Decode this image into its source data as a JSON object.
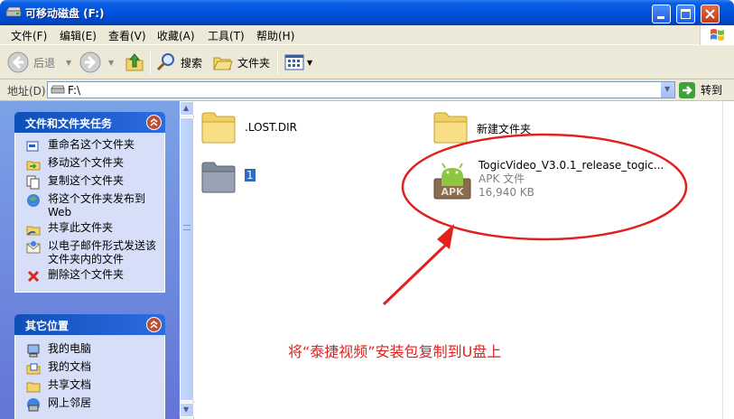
{
  "window": {
    "title": "可移动磁盘  (F:)"
  },
  "menu": [
    "文件(F)",
    "编辑(E)",
    "查看(V)",
    "收藏(A)",
    "工具(T)",
    "帮助(H)"
  ],
  "toolbar": {
    "back_label": "后退",
    "search_label": "搜索",
    "folders_label": "文件夹"
  },
  "address": {
    "label": "地址(D)",
    "value": "F:\\",
    "go_label": "转到"
  },
  "tasks_panel": {
    "title": "文件和文件夹任务",
    "items": [
      {
        "label": "重命名这个文件夹",
        "icon": "rename-icon"
      },
      {
        "label": "移动这个文件夹",
        "icon": "move-icon"
      },
      {
        "label": "复制这个文件夹",
        "icon": "copy-icon"
      },
      {
        "label": "将这个文件夹发布到 Web",
        "icon": "publish-web-icon"
      },
      {
        "label": "共享此文件夹",
        "icon": "share-icon"
      },
      {
        "label": "以电子邮件形式发送该文件夹内的文件",
        "icon": "email-icon"
      },
      {
        "label": "删除这个文件夹",
        "icon": "delete-icon"
      }
    ]
  },
  "places_panel": {
    "title": "其它位置",
    "items": [
      {
        "label": "我的电脑",
        "icon": "my-computer-icon"
      },
      {
        "label": "我的文档",
        "icon": "my-documents-icon"
      },
      {
        "label": "共享文档",
        "icon": "shared-documents-icon"
      },
      {
        "label": "网上邻居",
        "icon": "network-icon"
      }
    ]
  },
  "files": [
    {
      "name": ".LOST.DIR",
      "type": "folder"
    },
    {
      "name": "新建文件夹",
      "type": "folder"
    },
    {
      "name": "1",
      "type": "folder-selected"
    },
    {
      "name": "TogicVideo_V3.0.1_release_togic...",
      "type": "apk",
      "kind": "APK 文件",
      "size": "16,940 KB",
      "badge": "APK"
    }
  ],
  "annotation": "将“泰捷视频”安装包复制到U盘上",
  "colors": {
    "titlebar": "#0052dd",
    "annotation_red": "#e0211e",
    "pane_blue": "#6375d6"
  }
}
